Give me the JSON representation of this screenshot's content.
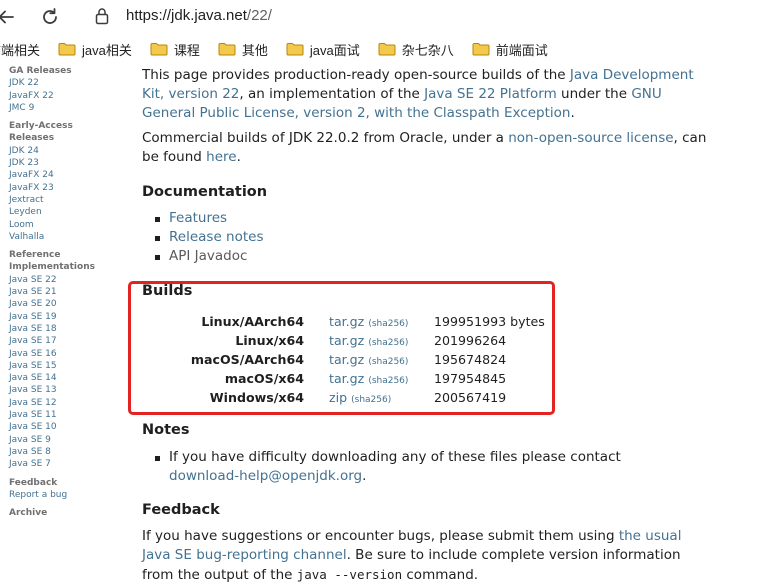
{
  "browser": {
    "url_host": "https://jdk.java.net",
    "url_path": "/22/",
    "bookmarks": [
      "前端相关",
      "java相关",
      "课程",
      "其他",
      "java面试",
      "杂七杂八",
      "前端面试"
    ]
  },
  "sidebar": {
    "groups": [
      {
        "heading": "GA Releases",
        "items": [
          "JDK 22",
          "JavaFX 22",
          "JMC 9"
        ]
      },
      {
        "heading": "Early-Access Releases",
        "items": [
          "JDK 24",
          "JDK 23",
          "JavaFX 24",
          "JavaFX 23",
          "Jextract",
          "Leyden",
          "Loom",
          "Valhalla"
        ]
      },
      {
        "heading": "Reference Implementations",
        "items": [
          "Java SE 22",
          "Java SE 21",
          "Java SE 20",
          "Java SE 19",
          "Java SE 18",
          "Java SE 17",
          "Java SE 16",
          "Java SE 15",
          "Java SE 14",
          "Java SE 13",
          "Java SE 12",
          "Java SE 11",
          "Java SE 10",
          "Java SE 9",
          "Java SE 8",
          "Java SE 7"
        ]
      },
      {
        "heading": "Feedback",
        "items": [
          "Report a bug"
        ]
      },
      {
        "heading": "Archive",
        "items": []
      }
    ]
  },
  "intro": {
    "t1": "This page provides production-ready open-source builds of the ",
    "l1": "Java Development Kit, version 22",
    "t2": ", an implementation of the ",
    "l2": "Java SE 22 Platform",
    "t3": " under the ",
    "l3": "GNU General Public License, version 2, with the Classpath Exception",
    "t4": "."
  },
  "commercial": {
    "t1": "Commercial builds of JDK 22.0.2 from Oracle, under a ",
    "l1": "non-open-source license",
    "t2": ", can be found ",
    "l2": "here",
    "t3": "."
  },
  "documentation": {
    "heading": "Documentation",
    "links": [
      "Features",
      "Release notes"
    ],
    "plain": "API Javadoc"
  },
  "builds": {
    "heading": "Builds",
    "rows": [
      {
        "os": "Linux/AArch64",
        "file": "tar.gz",
        "sha": "(sha256)",
        "size": "199951993 bytes"
      },
      {
        "os": "Linux/x64",
        "file": "tar.gz",
        "sha": "(sha256)",
        "size": "201996264"
      },
      {
        "os": "macOS/AArch64",
        "file": "tar.gz",
        "sha": "(sha256)",
        "size": "195674824"
      },
      {
        "os": "macOS/x64",
        "file": "tar.gz",
        "sha": "(sha256)",
        "size": "197954845"
      },
      {
        "os": "Windows/x64",
        "file": "zip",
        "sha": "(sha256)",
        "size": "200567419"
      }
    ],
    "highlight_color": "#e32222"
  },
  "notes": {
    "heading": "Notes",
    "text": "If you have difficulty downloading any of these files please contact",
    "link": "download-help@openjdk.org",
    "tail": "."
  },
  "feedback": {
    "heading": "Feedback",
    "t1": "If you have suggestions or encounter bugs, please submit them using ",
    "l1": "the usual Java SE bug-reporting channel",
    "t2": ". Be sure to include complete version information from the output of the ",
    "code": "java --version",
    "t3": " command."
  },
  "colors": {
    "link": "#437291",
    "text": "#1f1f1f",
    "sidebar_heading": "#707070"
  }
}
